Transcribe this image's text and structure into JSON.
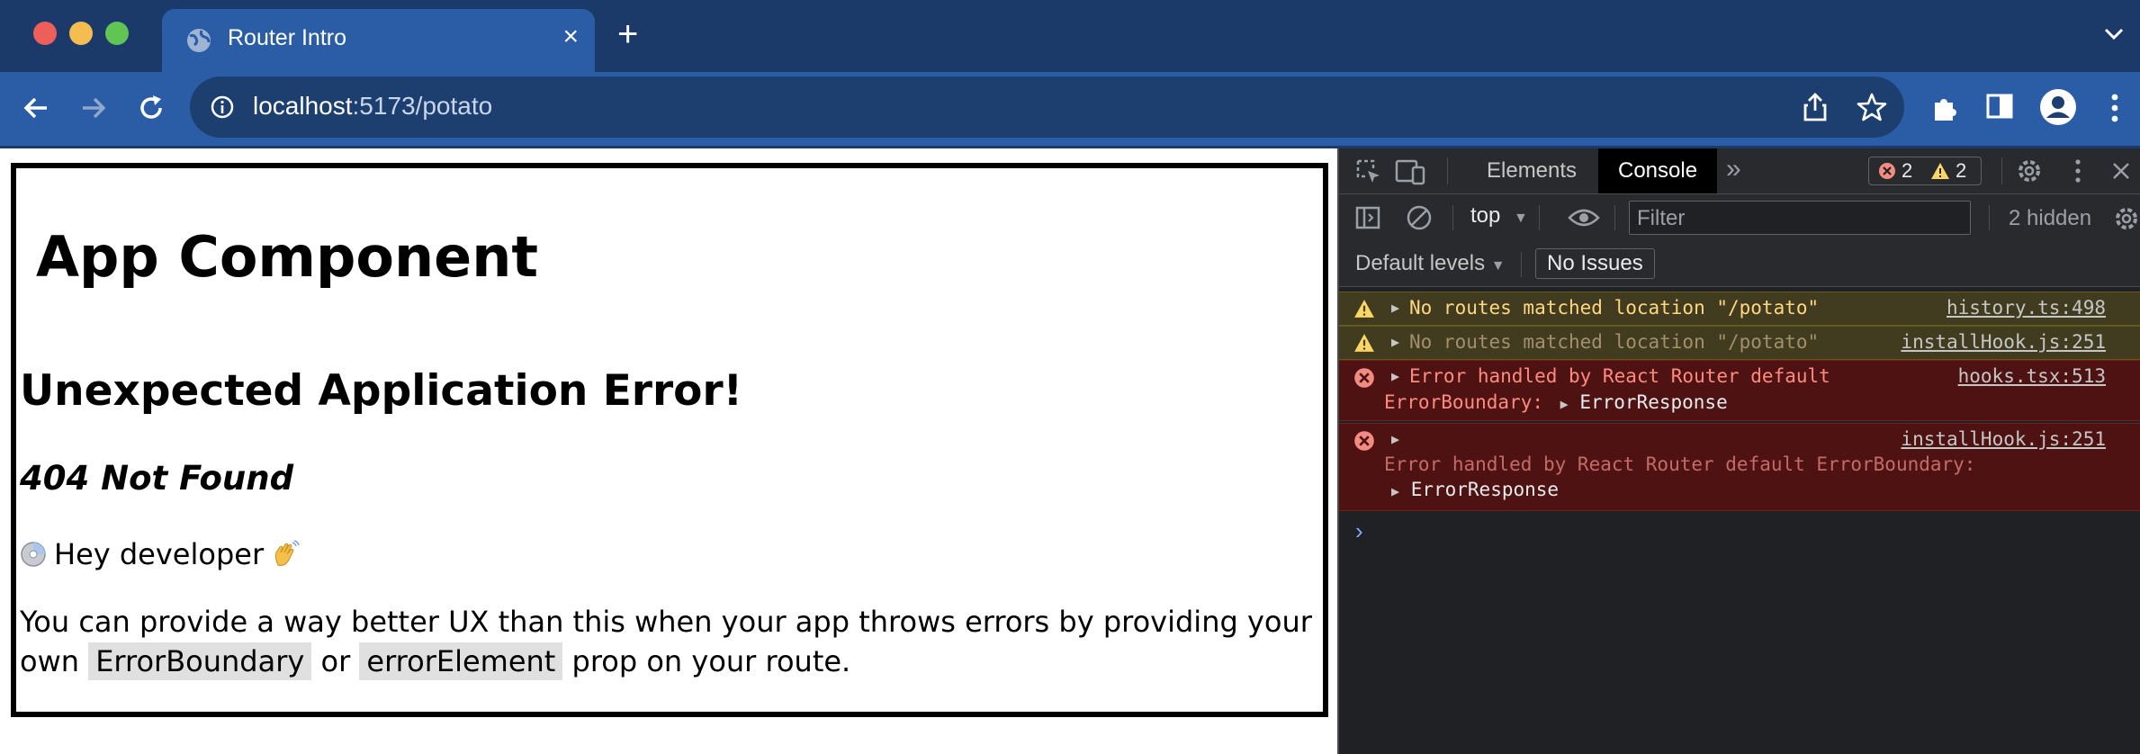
{
  "browser": {
    "tab_title": "Router Intro",
    "tab_close": "×",
    "new_tab": "+",
    "url_host": "localhost",
    "url_path": ":5173/potato"
  },
  "page": {
    "app_heading": "App Component",
    "error_title": "Unexpected Application Error!",
    "error_status": "404 Not Found",
    "hey_text": "Hey developer",
    "ux_text_before": "You can provide a way better UX than this when your app throws errors by providing your own ",
    "code_error_boundary": "ErrorBoundary",
    "ux_text_middle": " or ",
    "code_error_element": "errorElement",
    "ux_text_after": " prop on your route."
  },
  "devtools": {
    "tabs": [
      "Elements",
      "Console"
    ],
    "active_tab": "Console",
    "error_count": "2",
    "warning_count": "2",
    "context": "top",
    "filter_placeholder": "Filter",
    "hidden_count": "2 hidden",
    "default_levels": "Default levels",
    "issues_button": "No Issues",
    "messages": [
      {
        "level": "warning",
        "text": "No routes matched location \"/potato\"",
        "source": "history.ts:498"
      },
      {
        "level": "warning",
        "text": "No routes matched location \"/potato\"",
        "source": "installHook.js:251"
      },
      {
        "level": "error",
        "line1": "Error handled by React Router default",
        "line2_prefix": "ErrorBoundary:",
        "object": "ErrorResponse",
        "source": "hooks.tsx:513"
      },
      {
        "level": "error",
        "line1": "Error handled by React Router default ErrorBoundary:",
        "object": "ErrorResponse",
        "source": "installHook.js:251"
      }
    ],
    "prompt_symbol": "›"
  },
  "colors": {
    "chrome_dark": "#1b3a6a",
    "chrome_toolbar": "#2a5da5",
    "devtools_bg": "#202124",
    "warning_text": "#ffd780",
    "error_text": "#ff8a80"
  },
  "icons": [
    "globe-icon",
    "back-icon",
    "forward-icon",
    "reload-icon",
    "info-icon",
    "share-icon",
    "star-icon",
    "extensions-icon",
    "side-panel-icon",
    "profile-icon",
    "menu-icon",
    "inspect-icon",
    "device-icon",
    "more-tabs-icon",
    "error-icon",
    "warning-icon",
    "settings-icon",
    "close-icon",
    "sidebar-icon",
    "clear-icon",
    "eye-icon"
  ]
}
